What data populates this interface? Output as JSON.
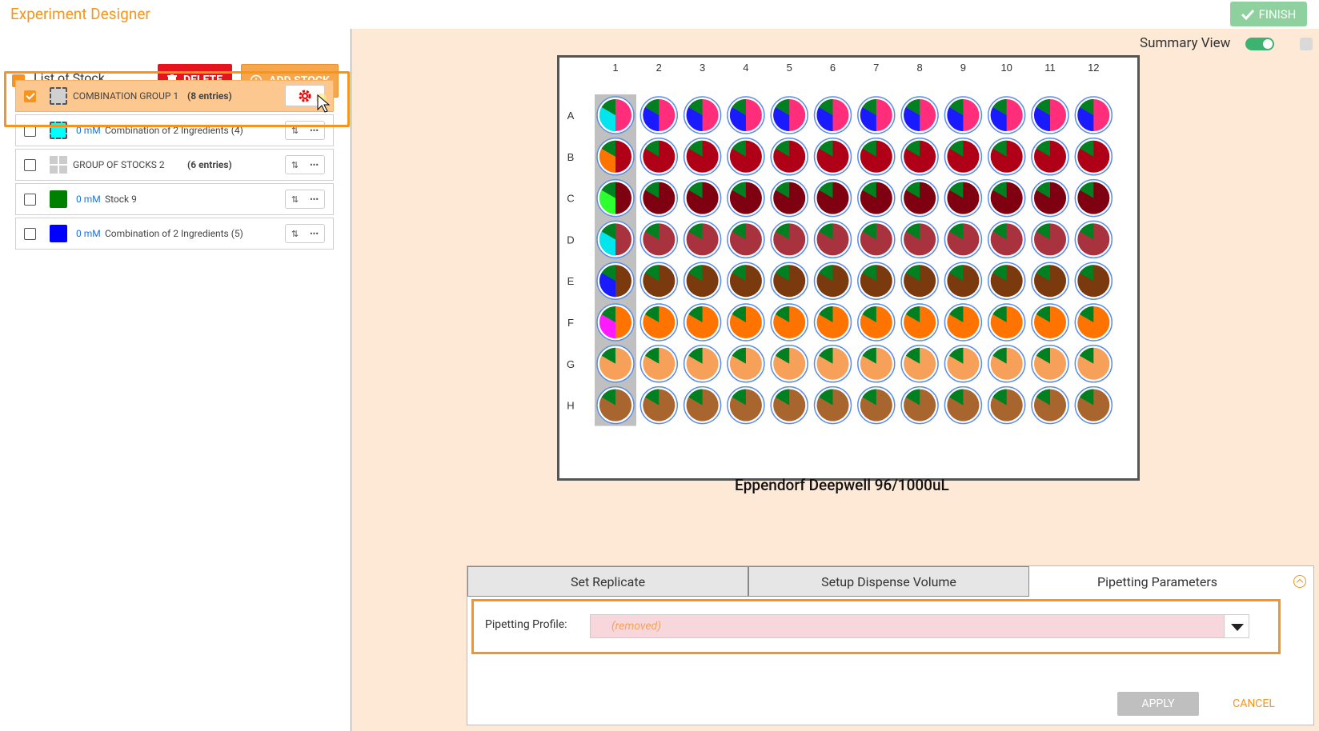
{
  "app": {
    "title": "Experiment Designer",
    "finish_label": "FINISH"
  },
  "stock_panel": {
    "title": "List of Stock",
    "delete_label": "DELETE",
    "add_label": "ADD STOCK",
    "rows": [
      {
        "name": "COMBINATION GROUP 1",
        "entries": "(8 entries)",
        "checked": true,
        "color": "#cccccc"
      },
      {
        "conc": "0 mM",
        "name": "Combination of 2 Ingredients (4)",
        "color": "#00ffff"
      },
      {
        "name": "GROUP OF STOCKS 2",
        "entries": "(6 entries)",
        "color": "#cccccc"
      },
      {
        "conc": "0 mM",
        "name": "Stock 9",
        "color": "#008000"
      },
      {
        "conc": "0 mM",
        "name": "Combination of 2 Ingredients (5)",
        "color": "#0000ff"
      }
    ]
  },
  "view": {
    "summary_label": "Summary View",
    "summary_enabled": true
  },
  "plate": {
    "name": "Eppendorf Deepwell 96/1000uL",
    "columns": [
      "1",
      "2",
      "3",
      "4",
      "5",
      "6",
      "7",
      "8",
      "9",
      "10",
      "11",
      "12"
    ],
    "rows": [
      "A",
      "B",
      "C",
      "D",
      "E",
      "F",
      "G",
      "H"
    ],
    "selected_column": "1",
    "row_colors": [
      "#ff2d7a",
      "#b00018",
      "#7f0010",
      "#a8323e",
      "#7a3a0e",
      "#ff7300",
      "#f7a05a",
      "#a8662e"
    ],
    "first_col_accents": [
      "#00e5ee",
      "#ff7300",
      "#2eff2e",
      "#00e5ee",
      "#1a1aff",
      "#ff1aff",
      "#f7a05a",
      "#a8662e"
    ],
    "secondary_accent": "#1a1aff",
    "wedge_color": "#008020"
  },
  "tabs": {
    "items": [
      "Set Replicate",
      "Setup Dispense Volume",
      "Pipetting Parameters"
    ],
    "active": "Pipetting Parameters",
    "profile_label": "Pipetting Profile:",
    "profile_value": "(removed)",
    "apply_label": "APPLY",
    "cancel_label": "CANCEL"
  }
}
